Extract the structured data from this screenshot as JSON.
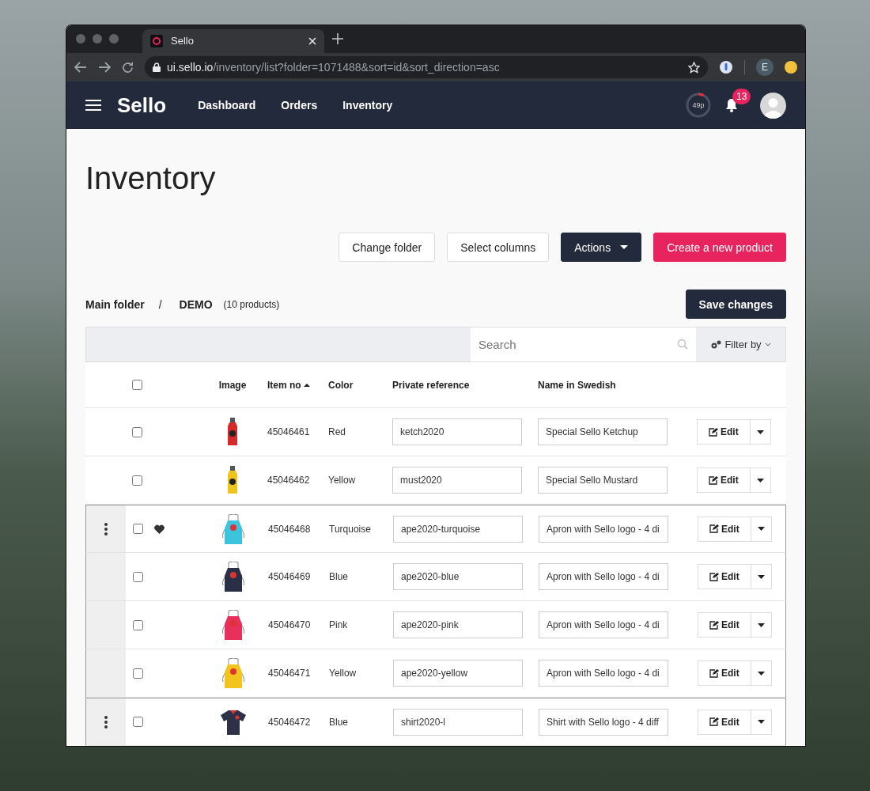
{
  "browser": {
    "tab_title": "Sello",
    "url_host": "ui.sello.io",
    "url_path": "/inventory/list?folder=1071488&sort=id&sort_direction=asc",
    "profile_initial": "E"
  },
  "navbar": {
    "logo": "Sello",
    "links": [
      {
        "label": "Dashboard"
      },
      {
        "label": "Orders"
      },
      {
        "label": "Inventory"
      }
    ],
    "usage_meter": {
      "label": "49p",
      "level": 0.08
    },
    "notification_count": "13"
  },
  "page_title": "Inventory",
  "toolbar_buttons": [
    {
      "label": "Change folder",
      "kind": "outline"
    },
    {
      "label": "Select columns",
      "kind": "outline"
    },
    {
      "label": "Actions",
      "kind": "dropdown"
    },
    {
      "label": "Create a new product",
      "kind": "primary"
    }
  ],
  "breadcrumb": {
    "items": [
      "Main folder",
      "DEMO"
    ],
    "separator": "/",
    "count": "(10 products)"
  },
  "save_button": "Save changes",
  "search": {
    "placeholder": "Search"
  },
  "filter_button": "Filter by",
  "table": {
    "select_all_checked": false,
    "columns": [
      {
        "label": "Image",
        "sorted": false
      },
      {
        "label": "Item no",
        "sorted": true
      },
      {
        "label": "Color",
        "sorted": false
      },
      {
        "label": "Private reference",
        "sorted": false
      },
      {
        "label": "Name in Swedish",
        "sorted": false
      }
    ],
    "rows": [
      {
        "kind": "single",
        "checked": false,
        "favorite": false,
        "image": {
          "kind": "bottle",
          "color": "#d62a2a"
        },
        "item_no": "45046461",
        "color_name": "Red",
        "private_reference": "ketch2020",
        "name_swedish": "Special Sello Ketchup",
        "action": "Edit"
      },
      {
        "kind": "single",
        "checked": false,
        "favorite": false,
        "image": {
          "kind": "bottle",
          "color": "#efc41c"
        },
        "item_no": "45046462",
        "color_name": "Yellow",
        "private_reference": "must2020",
        "name_swedish": "Special Sello Mustard",
        "action": "Edit"
      },
      {
        "kind": "group_parent",
        "checked": false,
        "favorite": true,
        "image": {
          "kind": "apron",
          "color": "#3cc4dc"
        },
        "item_no": "45046468",
        "color_name": "Turquoise",
        "private_reference": "ape2020-turquoise",
        "name_swedish": "Apron with Sello logo - 4 di",
        "action": "Edit"
      },
      {
        "kind": "group_member",
        "checked": false,
        "favorite": false,
        "image": {
          "kind": "apron",
          "color": "#2b2f45"
        },
        "item_no": "45046469",
        "color_name": "Blue",
        "private_reference": "ape2020-blue",
        "name_swedish": "Apron with Sello logo - 4 di",
        "action": "Edit"
      },
      {
        "kind": "group_member",
        "checked": false,
        "favorite": false,
        "image": {
          "kind": "apron",
          "color": "#e8305c"
        },
        "item_no": "45046470",
        "color_name": "Pink",
        "private_reference": "ape2020-pink",
        "name_swedish": "Apron with Sello logo - 4 di",
        "action": "Edit"
      },
      {
        "kind": "group_member",
        "checked": false,
        "favorite": false,
        "image": {
          "kind": "apron",
          "color": "#f2c51e"
        },
        "item_no": "45046471",
        "color_name": "Yellow",
        "private_reference": "ape2020-yellow",
        "name_swedish": "Apron with Sello logo - 4 di",
        "action": "Edit"
      },
      {
        "kind": "group_parent",
        "checked": false,
        "favorite": false,
        "image": {
          "kind": "shirt",
          "color": "#2d3147"
        },
        "item_no": "45046472",
        "color_name": "Blue",
        "private_reference": "shirt2020-l",
        "name_swedish": "Shirt with Sello logo - 4 diff",
        "action": "Edit"
      }
    ]
  }
}
